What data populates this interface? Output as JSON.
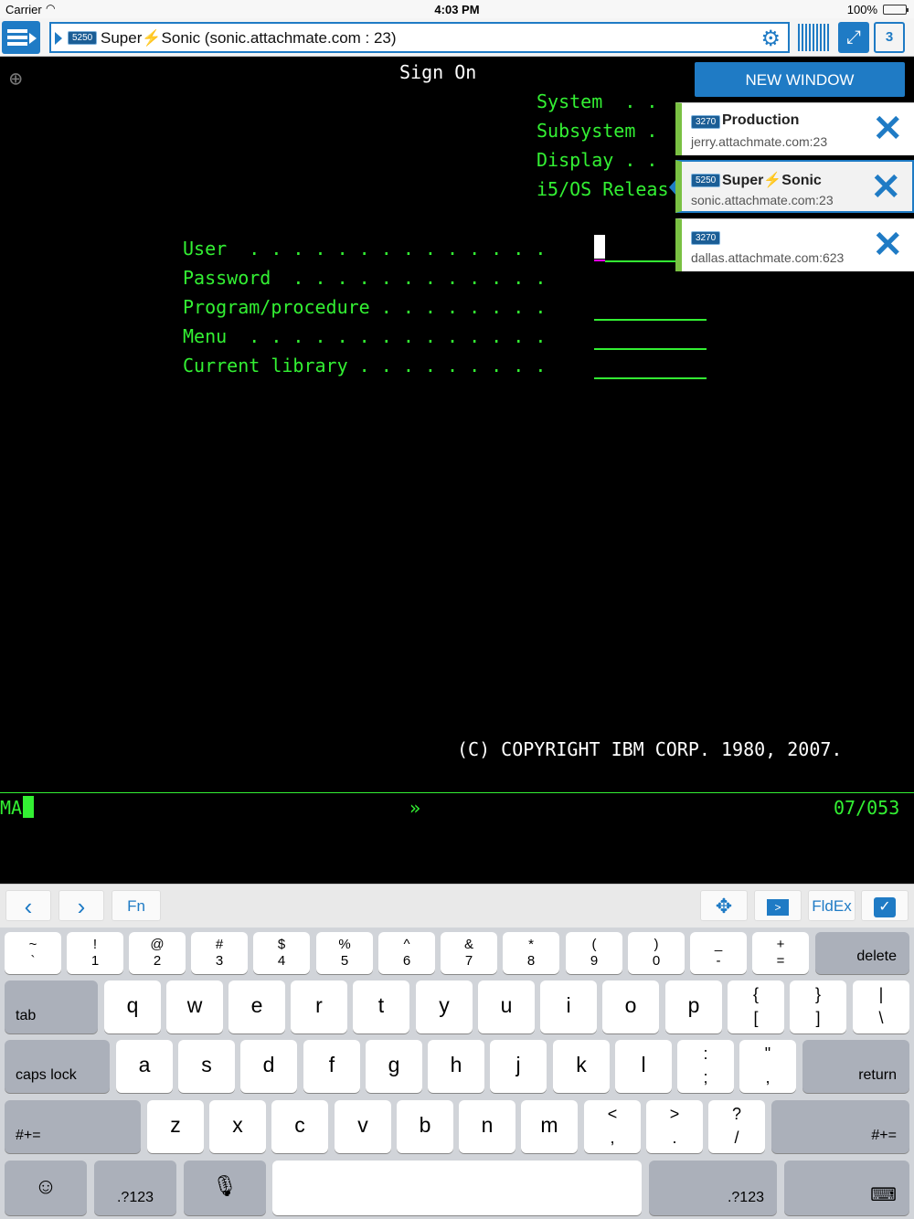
{
  "status_bar": {
    "carrier": "Carrier",
    "time": "4:03 PM",
    "battery": "100%"
  },
  "toolbar": {
    "session_badge": "5250",
    "session_title_a": "Super",
    "session_title_bolt": "⚡",
    "session_title_b": "Sonic (sonic.attachmate.com : 23)",
    "session_count": "3"
  },
  "terminal": {
    "title": "Sign On",
    "sys_labels": [
      "System  . .",
      "Subsystem .",
      "Display . .",
      "i5/OS Releas"
    ],
    "fields": [
      "User  . . . . . . . . . . . . . .",
      "Password  . . . . . . . . . . . .",
      "Program/procedure . . . . . . . .",
      "Menu  . . . . . . . . . . . . . .",
      "Current library . . . . . . . . ."
    ],
    "copyright": "(C) COPYRIGHT IBM CORP. 1980, 2007.",
    "oia_left": "MA",
    "oia_mid": "»",
    "oia_right": "07/053"
  },
  "session_popup": {
    "new_window_label": "NEW WINDOW",
    "sessions": [
      {
        "badge": "3270",
        "name": "Production",
        "host": "jerry.attachmate.com:23"
      },
      {
        "badge": "5250",
        "name_a": "Super",
        "name_bolt": "⚡",
        "name_b": "Sonic",
        "host": "sonic.attachmate.com:23"
      },
      {
        "badge": "3270",
        "name": "",
        "host": "dallas.attachmate.com:623"
      }
    ]
  },
  "accessory_bar": {
    "prev": "‹",
    "next": "›",
    "fn": "Fn",
    "fldex": "FldEx"
  },
  "keyboard": {
    "row1": [
      {
        "t": "~",
        "b": "`"
      },
      {
        "t": "!",
        "b": "1"
      },
      {
        "t": "@",
        "b": "2"
      },
      {
        "t": "#",
        "b": "3"
      },
      {
        "t": "$",
        "b": "4"
      },
      {
        "t": "%",
        "b": "5"
      },
      {
        "t": "^",
        "b": "6"
      },
      {
        "t": "&",
        "b": "7"
      },
      {
        "t": "*",
        "b": "8"
      },
      {
        "t": "(",
        "b": "9"
      },
      {
        "t": ")",
        "b": "0"
      },
      {
        "t": "_",
        "b": "-"
      },
      {
        "t": "+",
        "b": "="
      }
    ],
    "delete": "delete",
    "tab": "tab",
    "row2": [
      "q",
      "w",
      "e",
      "r",
      "t",
      "y",
      "u",
      "i",
      "o",
      "p"
    ],
    "row2_sym": [
      {
        "t": "{",
        "b": "["
      },
      {
        "t": "}",
        "b": "]"
      },
      {
        "t": "|",
        "b": "\\"
      }
    ],
    "caps": "caps lock",
    "row3": [
      "a",
      "s",
      "d",
      "f",
      "g",
      "h",
      "j",
      "k",
      "l"
    ],
    "row3_sym": [
      {
        "t": ":",
        "b": ";"
      },
      {
        "t": "\"",
        "b": ","
      }
    ],
    "return": "return",
    "shift_sym": "#+=",
    "row4": [
      "z",
      "x",
      "c",
      "v",
      "b",
      "n",
      "m"
    ],
    "row4_sym": [
      {
        "t": "<",
        "b": ","
      },
      {
        "t": ">",
        "b": "."
      },
      {
        "t": "?",
        "b": "/"
      }
    ],
    "num": ".?123"
  }
}
